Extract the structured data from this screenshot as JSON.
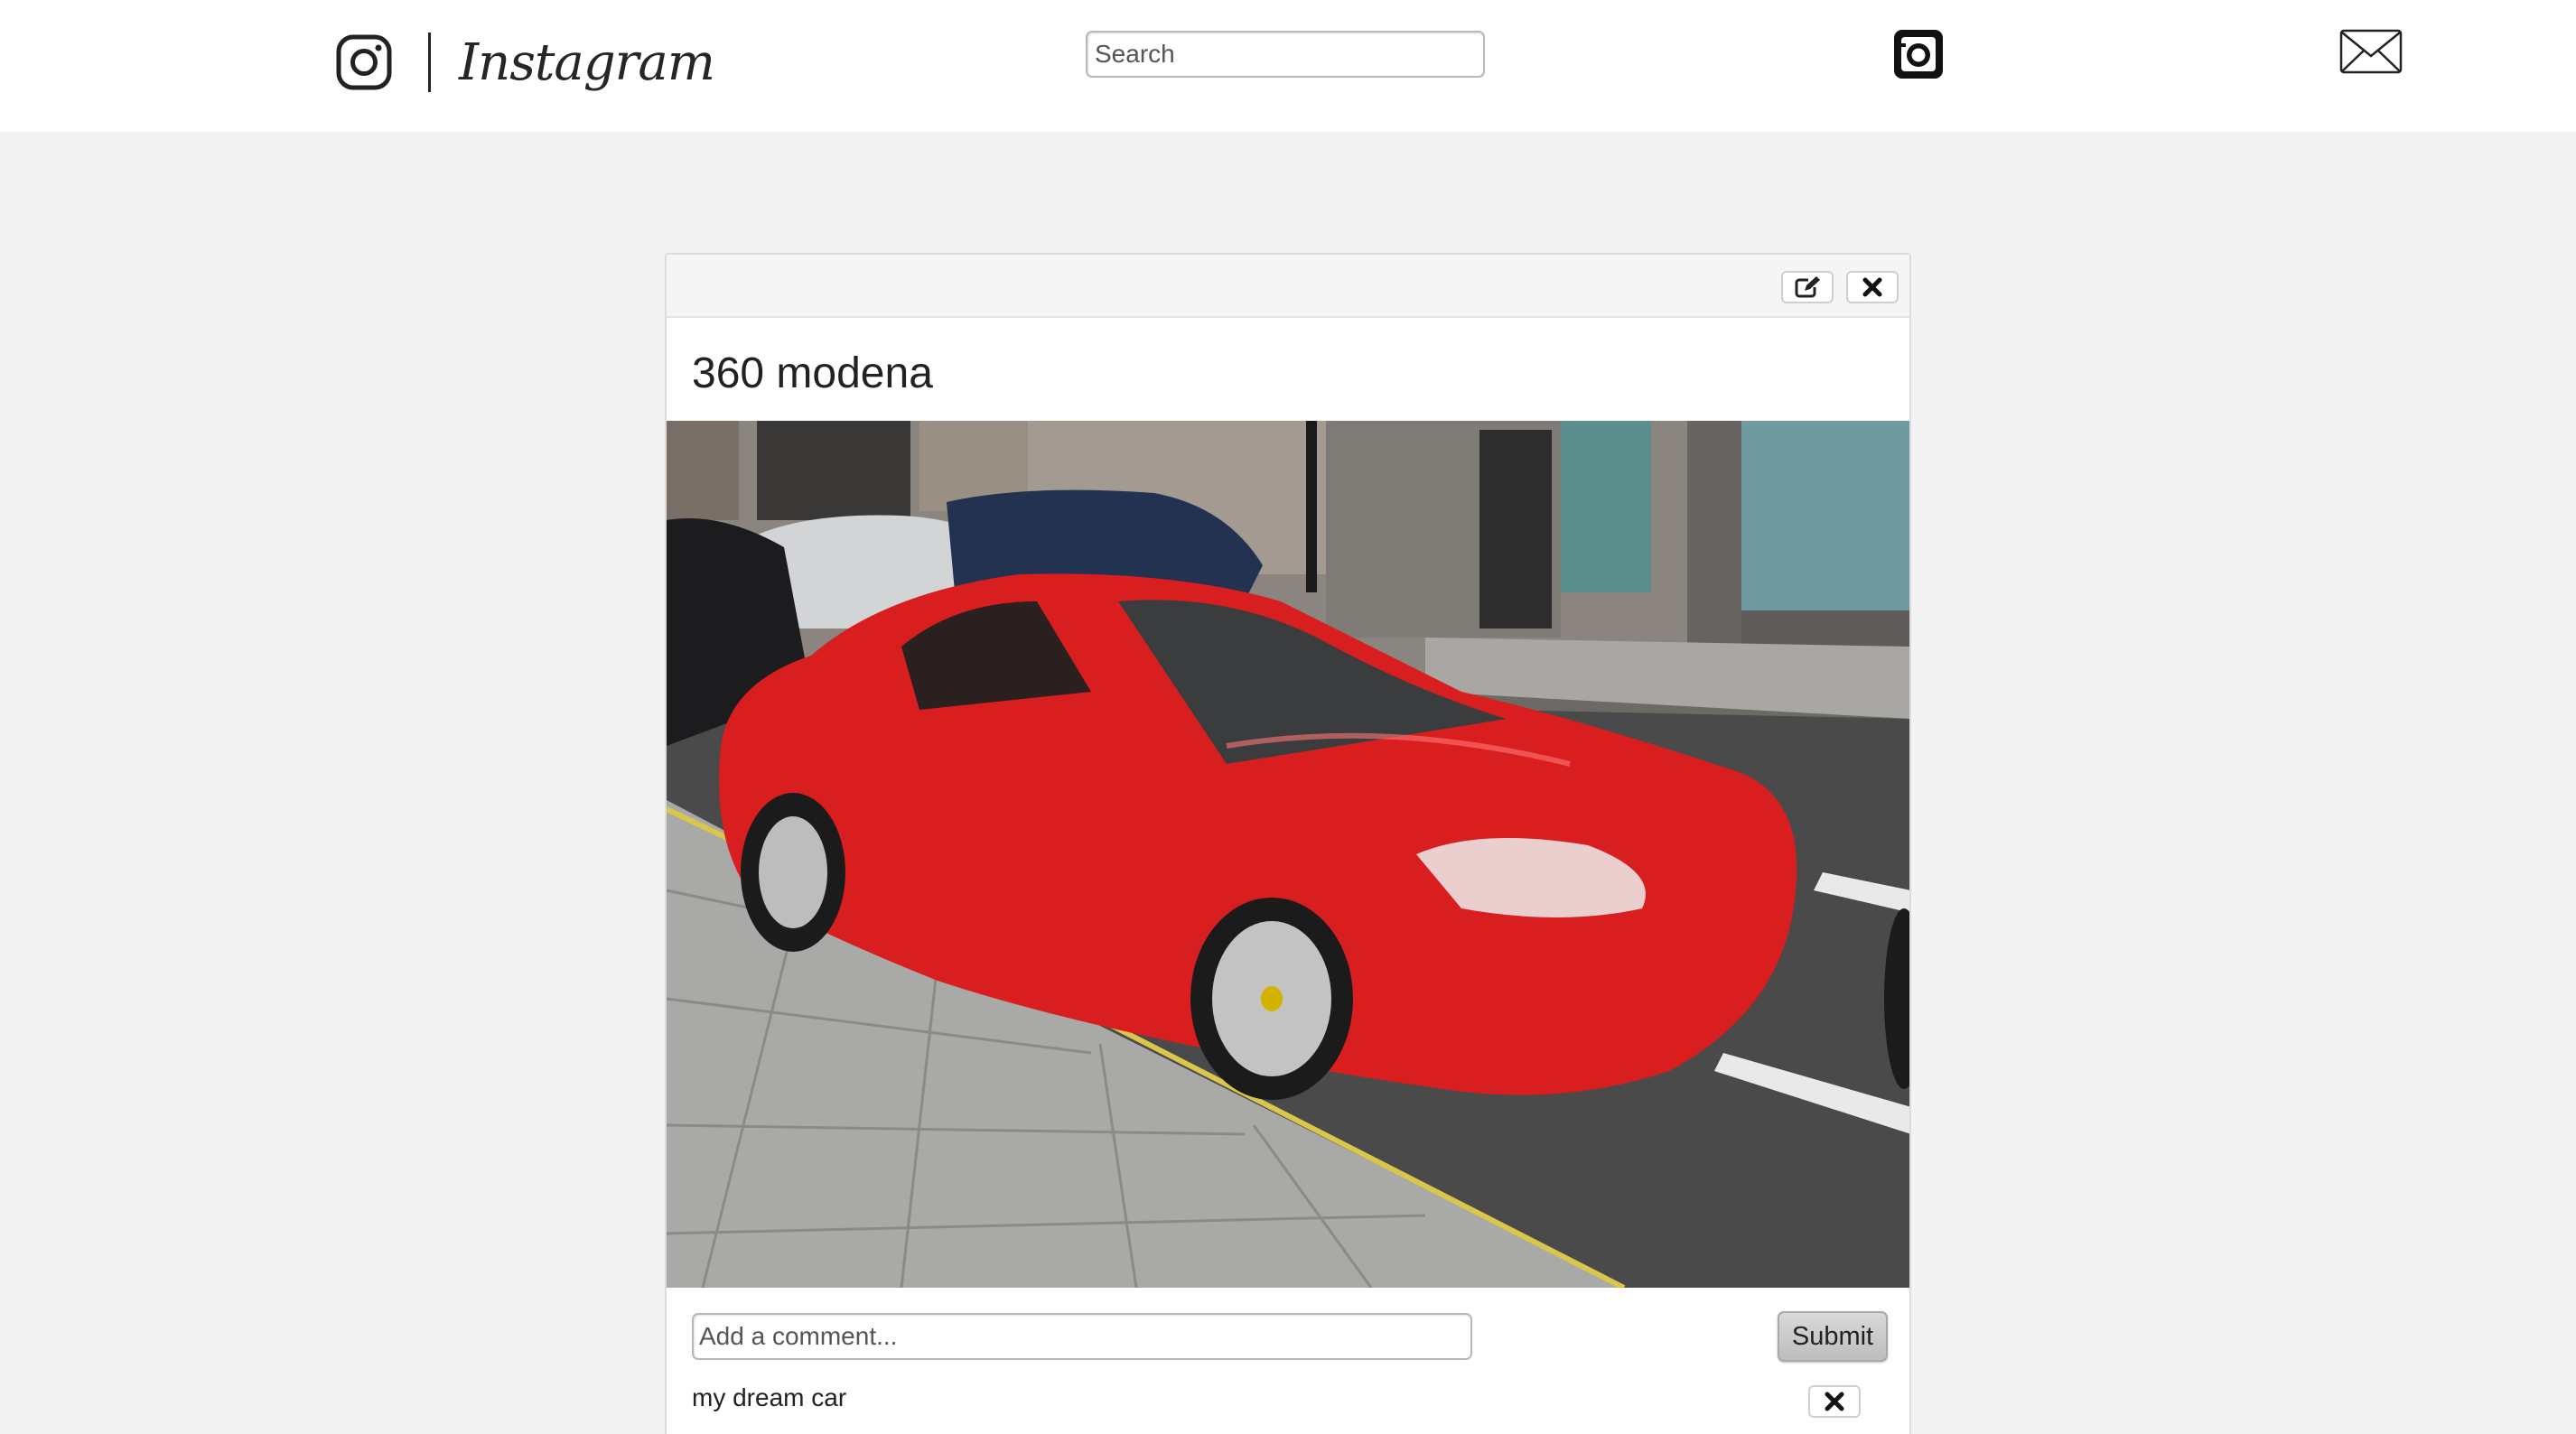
{
  "header": {
    "brand": "Instagram",
    "logo_icon": "instagram-logo-icon",
    "search_placeholder": "Search",
    "nav": [
      {
        "icon": "camera-icon"
      },
      {
        "icon": "mail-icon"
      }
    ]
  },
  "post": {
    "title": "360 modena",
    "toolbar": [
      {
        "icon": "edit-icon"
      },
      {
        "icon": "close-icon"
      }
    ],
    "photo": "red sports car parked on city street",
    "comment_placeholder": "Add a comment...",
    "submit_label": "Submit",
    "comments": [
      {
        "text": "my dream car",
        "delete_icon": "close-icon"
      }
    ]
  },
  "colors": {
    "page_bg": "#f3f3f3",
    "header_bg": "#ffffff",
    "car_red": "#d81e1e"
  }
}
